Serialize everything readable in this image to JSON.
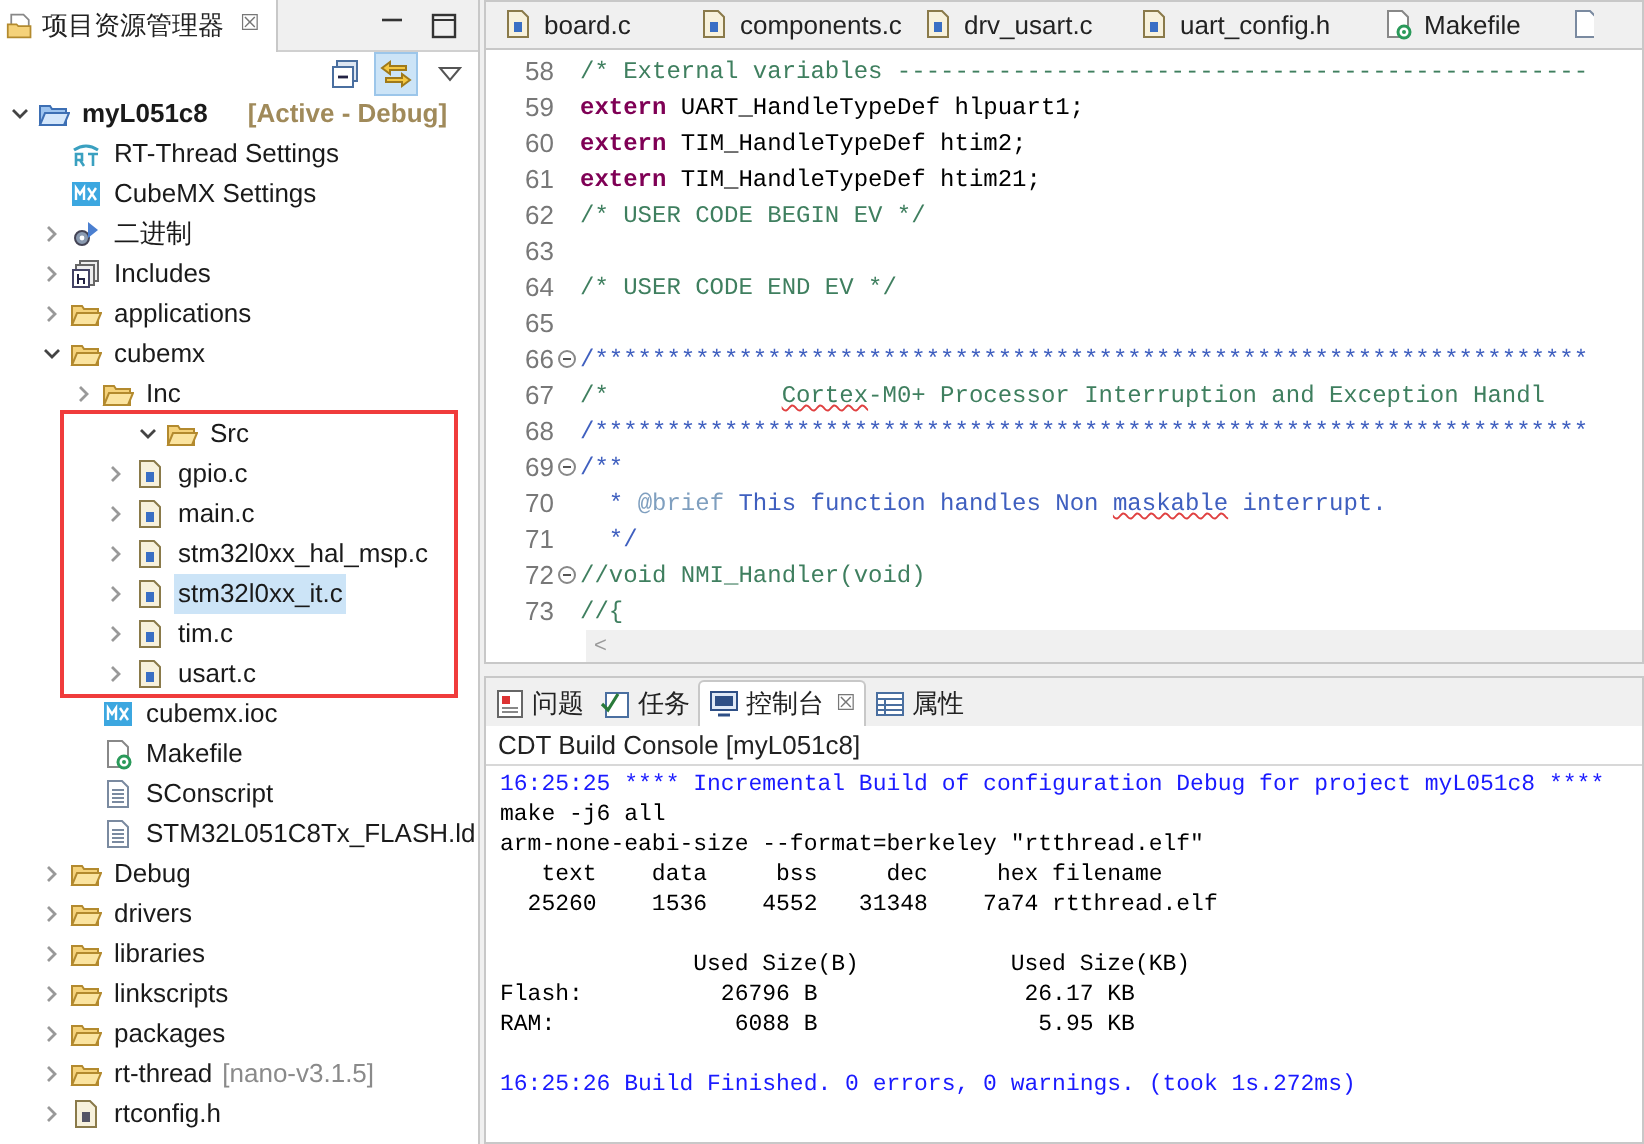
{
  "explorer": {
    "tab": {
      "label": "项目资源管理器",
      "close": "☒"
    },
    "toolbar": {
      "link_pressed": true
    },
    "tree": [
      {
        "label": "myL051c8",
        "kind": "project",
        "bold": true,
        "build_config": "[Active - Debug]",
        "expanded": true,
        "selected": false,
        "children": [
          {
            "label": "RT-Thread Settings",
            "kind": "rt",
            "selected": false
          },
          {
            "label": "CubeMX Settings",
            "kind": "mx",
            "selected": false
          },
          {
            "label": "二进制",
            "kind": "binary",
            "expanded": false,
            "selected": false
          },
          {
            "label": "Includes",
            "kind": "includes",
            "expanded": false,
            "selected": false
          },
          {
            "label": "applications",
            "kind": "folder",
            "expanded": false,
            "selected": false
          },
          {
            "label": "cubemx",
            "kind": "folder",
            "expanded": true,
            "selected": false,
            "children": [
              {
                "label": "Inc",
                "kind": "folder",
                "expanded": false,
                "selected": false
              },
              {
                "label": "Src",
                "kind": "folder",
                "expanded": true,
                "selected": false,
                "highlighted": true,
                "children": [
                  {
                    "label": "gpio.c",
                    "kind": "cfile",
                    "expanded": false,
                    "selected": false
                  },
                  {
                    "label": "main.c",
                    "kind": "cfile",
                    "expanded": false,
                    "selected": false
                  },
                  {
                    "label": "stm32l0xx_hal_msp.c",
                    "kind": "cfile",
                    "expanded": false,
                    "selected": false
                  },
                  {
                    "label": "stm32l0xx_it.c",
                    "kind": "cfile",
                    "expanded": false,
                    "selected": true
                  },
                  {
                    "label": "tim.c",
                    "kind": "cfile",
                    "expanded": false,
                    "selected": false
                  },
                  {
                    "label": "usart.c",
                    "kind": "cfile",
                    "expanded": false,
                    "selected": false
                  }
                ]
              },
              {
                "label": "cubemx.ioc",
                "kind": "mx",
                "selected": false
              },
              {
                "label": "Makefile",
                "kind": "makefile",
                "selected": false
              },
              {
                "label": "SConscript",
                "kind": "text",
                "selected": false
              },
              {
                "label": "STM32L051C8Tx_FLASH.ld",
                "kind": "text",
                "selected": false
              }
            ]
          },
          {
            "label": "Debug",
            "kind": "folder",
            "expanded": false,
            "selected": false
          },
          {
            "label": "drivers",
            "kind": "folder",
            "expanded": false,
            "selected": false
          },
          {
            "label": "libraries",
            "kind": "folder",
            "expanded": false,
            "selected": false
          },
          {
            "label": "linkscripts",
            "kind": "folder",
            "expanded": false,
            "selected": false
          },
          {
            "label": "packages",
            "kind": "folder",
            "expanded": false,
            "selected": false
          },
          {
            "label": "rt-thread",
            "kind": "folder",
            "version": "[nano-v3.1.5]",
            "expanded": false,
            "selected": false
          },
          {
            "label": "rtconfig.h",
            "kind": "hfile",
            "expanded": false,
            "selected": false
          }
        ]
      }
    ]
  },
  "editor": {
    "tabs": [
      {
        "label": "board.c",
        "kind": "cfile",
        "selected": false
      },
      {
        "label": "components.c",
        "kind": "cfile",
        "selected": false
      },
      {
        "label": "drv_usart.c",
        "kind": "cfile",
        "selected": false
      },
      {
        "label": "uart_config.h",
        "kind": "cfile",
        "selected": false
      },
      {
        "label": "Makefile",
        "kind": "makefile",
        "selected": false
      }
    ],
    "lines": [
      {
        "number": "58",
        "foldable": false,
        "segments": [
          {
            "kind": "comment",
            "text": "/* External variables ------------------------------------------------"
          }
        ]
      },
      {
        "number": "59",
        "foldable": false,
        "segments": [
          {
            "kind": "keyword",
            "text": "extern"
          },
          {
            "kind": "plain",
            "text": " UART_HandleTypeDef hlpuart1;"
          }
        ]
      },
      {
        "number": "60",
        "foldable": false,
        "segments": [
          {
            "kind": "keyword",
            "text": "extern"
          },
          {
            "kind": "plain",
            "text": " TIM_HandleTypeDef htim2;"
          }
        ]
      },
      {
        "number": "61",
        "foldable": false,
        "segments": [
          {
            "kind": "keyword",
            "text": "extern"
          },
          {
            "kind": "plain",
            "text": " TIM_HandleTypeDef htim21;"
          }
        ]
      },
      {
        "number": "62",
        "foldable": false,
        "segments": [
          {
            "kind": "comment",
            "text": "/* USER CODE BEGIN EV */"
          }
        ]
      },
      {
        "number": "63",
        "foldable": false
      },
      {
        "number": "64",
        "foldable": false,
        "segments": [
          {
            "kind": "comment",
            "text": "/* USER CODE END EV */"
          }
        ]
      },
      {
        "number": "65",
        "foldable": false
      },
      {
        "number": "66",
        "foldable": true,
        "segments": [
          {
            "kind": "doc",
            "text": "/*********************************************************************"
          }
        ]
      },
      {
        "number": "67",
        "foldable": false,
        "segments": [
          {
            "kind": "comment",
            "text": "/*            "
          },
          {
            "kind": "comment",
            "text": "Cortex",
            "misspelled": true
          },
          {
            "kind": "comment",
            "text": "-M0+ Processor Interruption and Exception Handl"
          }
        ]
      },
      {
        "number": "68",
        "foldable": false,
        "segments": [
          {
            "kind": "doc",
            "text": "/*********************************************************************"
          }
        ]
      },
      {
        "number": "69",
        "foldable": true,
        "segments": [
          {
            "kind": "doc",
            "text": "/**"
          }
        ]
      },
      {
        "number": "70",
        "foldable": false,
        "segments": [
          {
            "kind": "doc",
            "text": "  * "
          },
          {
            "kind": "doctag",
            "text": "@brief"
          },
          {
            "kind": "doc",
            "text": " This function handles Non "
          },
          {
            "kind": "doc",
            "text": "maskable",
            "misspelled": true
          },
          {
            "kind": "doc",
            "text": " interrupt."
          }
        ]
      },
      {
        "number": "71",
        "foldable": false,
        "segments": [
          {
            "kind": "doc",
            "text": "  */"
          }
        ]
      },
      {
        "number": "72",
        "foldable": true,
        "segments": [
          {
            "kind": "comment",
            "text": "//void NMI_Handler(void)"
          }
        ]
      },
      {
        "number": "73",
        "foldable": false,
        "segments": [
          {
            "kind": "comment",
            "text": "//{"
          }
        ]
      }
    ],
    "scroll_left": "<"
  },
  "bottom": {
    "tabs": [
      {
        "label": "问题",
        "kind": "problems",
        "selected": false
      },
      {
        "label": "任务",
        "kind": "tasks",
        "selected": false
      },
      {
        "label": "控制台",
        "kind": "console",
        "selected": true,
        "close": "☒"
      },
      {
        "label": "属性",
        "kind": "properties",
        "selected": false
      }
    ],
    "console_title": "CDT Build Console [myL051c8]",
    "console": [
      {
        "kind": "info",
        "text": "16:25:25 **** Incremental Build of configuration Debug for project myL051c8 ****"
      },
      {
        "kind": "output",
        "text": "make -j6 all"
      },
      {
        "kind": "output",
        "text": "arm-none-eabi-size --format=berkeley \"rtthread.elf\""
      },
      {
        "kind": "output",
        "text": "   text    data     bss     dec     hex filename"
      },
      {
        "kind": "output",
        "text": "  25260    1536    4552   31348    7a74 rtthread.elf"
      },
      {
        "kind": "blank"
      },
      {
        "kind": "output",
        "text": "              Used Size(B)           Used Size(KB)"
      },
      {
        "kind": "output",
        "text": "Flash:          26796 B               26.17 KB"
      },
      {
        "kind": "output",
        "text": "RAM:             6088 B                5.95 KB"
      },
      {
        "kind": "blank"
      },
      {
        "kind": "info",
        "text": "16:25:26 Build Finished. 0 errors, 0 warnings. (took 1s.272ms)"
      }
    ]
  }
}
